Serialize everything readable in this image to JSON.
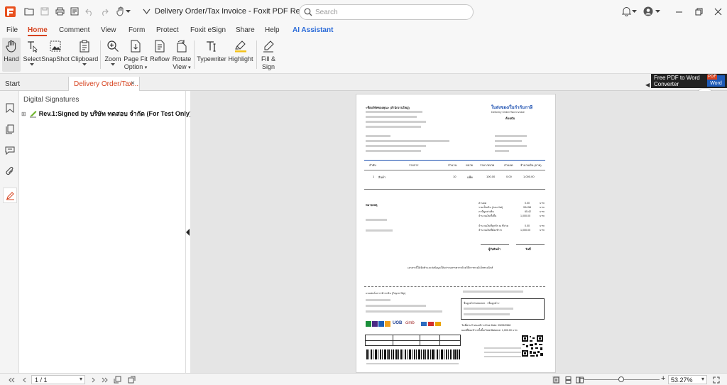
{
  "app": {
    "title": "Delivery Order/Tax Invoice - Foxit PDF Reader"
  },
  "search": {
    "placeholder": "Search"
  },
  "menu": [
    "File",
    "Home",
    "Comment",
    "View",
    "Form",
    "Protect",
    "Foxit eSign",
    "Share",
    "Help",
    "AI Assistant"
  ],
  "ribbon": {
    "hand": "Hand",
    "select": "Select",
    "snapshot": "SnapShot",
    "clipboard": "Clipboard",
    "zoom": "Zoom",
    "page_fit_1": "Page Fit",
    "page_fit_2": "Option",
    "reflow": "Reflow",
    "rotate_1": "Rotate",
    "rotate_2": "View",
    "typewriter": "Typewriter",
    "highlight": "Highlight",
    "fill_sign_1": "Fill &",
    "fill_sign_2": "Sign"
  },
  "tabs": {
    "start": "Start",
    "doc": "Delivery Order/Tax...",
    "close": "×"
  },
  "banner": {
    "line1": "Free PDF to Word",
    "line2": "Converter",
    "pdf": "PDF",
    "word": "Word"
  },
  "signatures": {
    "title": "Digital Signatures",
    "entry_prefix": "Rev.1:",
    "entry_label": "Signed by บริษัท ทดสอบ จำกัด (For Test Only)"
  },
  "document": {
    "company": "<ชื่อบริษัทของคุณ> (สำนักงานใหญ่)",
    "doc_title_th": "ใบส่งของ/ใบกำกับภาษี",
    "doc_title_en": "Delivery Order/Tax Invoice",
    "original": "ต้นฉบับ",
    "columns": [
      "ลำดับ",
      "รายการ",
      "จำนวน",
      "หน่วย",
      "ราคา/หน่วย",
      "ส่วนลด",
      "จำนวนเงิน (บาท)"
    ],
    "row": [
      "1",
      "สินค้า",
      "10",
      "แพ็ค",
      "100.00",
      "0.00",
      "1,000.00"
    ],
    "remarks": "หมายเหตุ",
    "totals": [
      [
        "ส่วนลด",
        "0.00",
        "บาท"
      ],
      [
        "รวมเป็นเงิน (ก่อน Vat)",
        "934.58",
        "บาท"
      ],
      [
        "ภาษีมูลค่าเพิ่ม",
        "65.42",
        "บาท"
      ],
      [
        "จำนวนเงินทั้งสิ้น",
        "1,000.00",
        "บาท"
      ],
      [
        "จำนวนเงินที่ถูกหัก ณ ที่จ่าย",
        "0.00",
        "บาท"
      ],
      [
        "จำนวนเงินที่ต้องชำระ",
        "1,000.00",
        "บาท"
      ]
    ],
    "receiver": "ผู้รับสินค้า",
    "date_label": "วันที่",
    "footer_note": "เอกสารนี้ได้จัดทำและส่งข้อมูลให้แก่กรมสรรพากรด้วยวิธีการทางอิเล็กทรอนิกส์",
    "payin": "แบบฟอร์มการชำระเงิน (Pay-in Slip)",
    "customer": "ชื่อลูกค้า/Customer : <ชื่อลูกค้า>",
    "due": "วันที่ครบกำหนดชำระ/Due Date: 05/05/2568",
    "total_balance": "ยอดที่ต้องชำระทั้งสิ้น/Total Balance: 1,000.00 บาท",
    "bank_uob": "UOB",
    "bank_cimb": "cimb"
  },
  "status": {
    "page": "1 / 1",
    "zoom": "53.27%",
    "dropdown_arrow": "▾",
    "zoom_minus": "−",
    "zoom_plus": "+"
  }
}
